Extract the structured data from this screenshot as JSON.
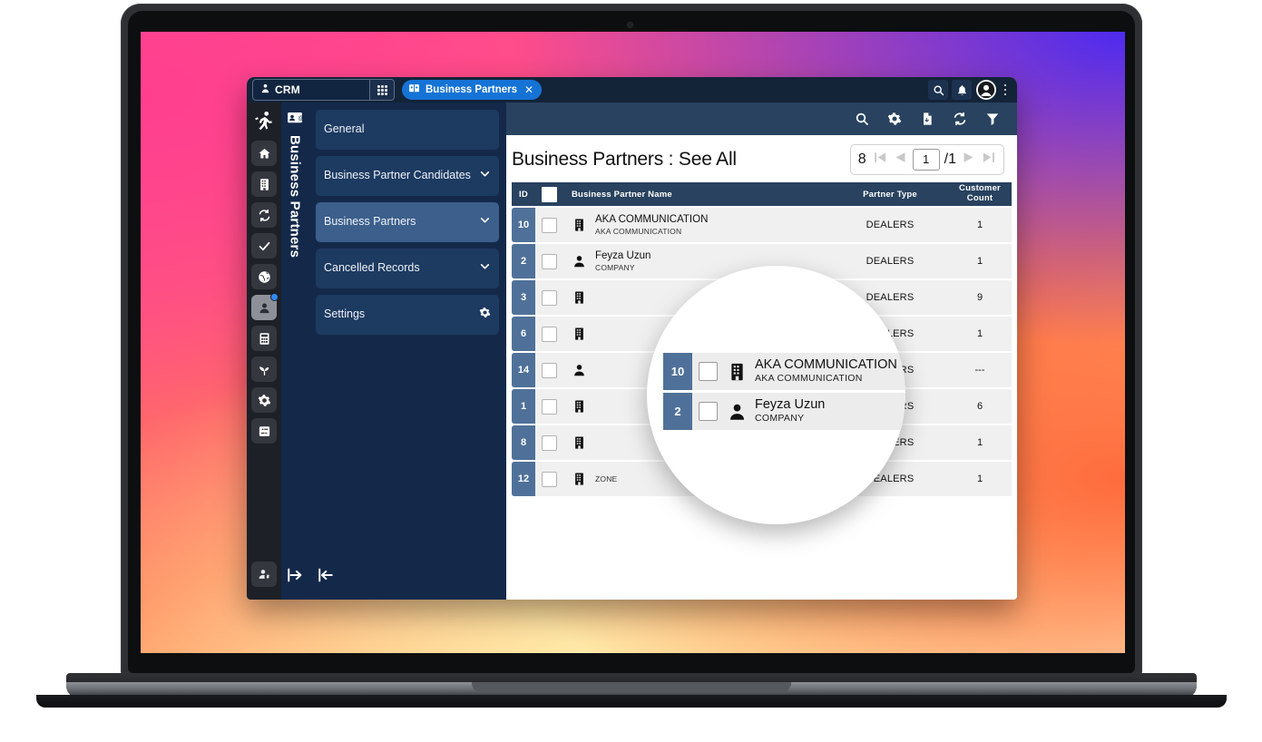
{
  "titlebar": {
    "app_label": "CRM",
    "app_icon": "user-tie-icon",
    "grid_icon": "app-grid-icon",
    "tab": {
      "label": "Business Partners",
      "icon": "address-book-icon",
      "close": "✕"
    },
    "right_icons": [
      "search-icon",
      "bell-icon",
      "account-avatar-icon",
      "kebab-menu-icon"
    ]
  },
  "rail": {
    "logo_icon": "running-man-logo",
    "items": [
      {
        "icon": "home-icon",
        "name": "home"
      },
      {
        "icon": "building-icon",
        "name": "organization"
      },
      {
        "icon": "sync-icon",
        "name": "processes"
      },
      {
        "icon": "check-icon",
        "name": "tasks"
      },
      {
        "icon": "globe-icon",
        "name": "web"
      },
      {
        "icon": "contact-person-icon",
        "name": "crm",
        "active": true,
        "badge": true
      },
      {
        "icon": "calculator-icon",
        "name": "finance"
      },
      {
        "icon": "sprout-icon",
        "name": "growth"
      },
      {
        "icon": "gear-icon",
        "name": "settings"
      },
      {
        "icon": "sliders-icon",
        "name": "preferences"
      }
    ],
    "bottom_icon": "user-settings-icon"
  },
  "module_strip": {
    "icon": "contact-card-icon",
    "label": "Business Partners",
    "expand_icon": "expand-right-icon"
  },
  "menu": {
    "items": [
      {
        "label": "General",
        "chevron": false,
        "gear": false,
        "selected": false
      },
      {
        "label": "Business Partner Candidates",
        "chevron": true,
        "gear": false,
        "selected": false
      },
      {
        "label": "Business Partners",
        "chevron": true,
        "gear": false,
        "selected": true
      },
      {
        "label": "Cancelled Records",
        "chevron": true,
        "gear": false,
        "selected": false
      },
      {
        "label": "Settings",
        "chevron": false,
        "gear": true,
        "selected": false
      }
    ],
    "collapse_icon": "collapse-left-icon"
  },
  "toolbar": {
    "icons": [
      "search-icon",
      "gear-icon",
      "export-file-icon",
      "refresh-icon",
      "filter-icon"
    ]
  },
  "page": {
    "title": "Business Partners : See All",
    "pager": {
      "total": "8",
      "first_icon": "first-page-icon",
      "prev_icon": "prev-page-icon",
      "current": "1",
      "separator": "/1",
      "next_icon": "next-page-icon",
      "last_icon": "last-page-icon"
    }
  },
  "table": {
    "columns": [
      "ID",
      "",
      "Business Partner Name",
      "Partner Type",
      "Customer Count"
    ],
    "header": {
      "id": "ID",
      "name": "Business Partner Name",
      "type": "Partner Type",
      "count_line1": "Customer",
      "count_line2": "Count"
    },
    "rows": [
      {
        "id": "10",
        "icon": "building-icon",
        "name": "AKA COMMUNICATION",
        "subtitle": "AKA COMMUNICATION",
        "type": "DEALERS",
        "count": "1"
      },
      {
        "id": "2",
        "icon": "person-icon",
        "name": "Feyza Uzun",
        "subtitle": "COMPANY",
        "type": "DEALERS",
        "count": "1"
      },
      {
        "id": "3",
        "icon": "building-icon",
        "name": "",
        "subtitle": "",
        "type": "DEALERS",
        "count": "9"
      },
      {
        "id": "6",
        "icon": "building-icon",
        "name": "",
        "subtitle": "",
        "type": "DEALERS",
        "count": "1"
      },
      {
        "id": "14",
        "icon": "person-icon",
        "name": "",
        "subtitle": "",
        "type": "DEALERS",
        "count": "---"
      },
      {
        "id": "1",
        "icon": "building-icon",
        "name": "",
        "subtitle": "",
        "type": "DEALERS",
        "count": "6"
      },
      {
        "id": "8",
        "icon": "building-icon",
        "name": "",
        "subtitle": "",
        "type": "DEALERS",
        "count": "1"
      },
      {
        "id": "12",
        "icon": "building-icon",
        "name": "",
        "subtitle": "ZONE",
        "type": "DEALERS",
        "count": "1"
      }
    ]
  },
  "magnifier": {
    "rows": [
      {
        "id": "10",
        "icon": "building-icon",
        "name": "AKA COMMUNICATION",
        "subtitle": "AKA COMMUNICATION"
      },
      {
        "id": "2",
        "icon": "person-icon",
        "name": "Feyza Uzun",
        "subtitle": "COMPANY"
      }
    ]
  },
  "colors": {
    "titlebar": "#132338",
    "nav_dark": "#14294a",
    "rail": "#1d2027",
    "toolbar": "#28425f",
    "accent_blue": "#1573d6",
    "id_badge": "#4f7199",
    "row_bg": "#f0f0f0",
    "menu_selected": "#3c5f8c"
  }
}
